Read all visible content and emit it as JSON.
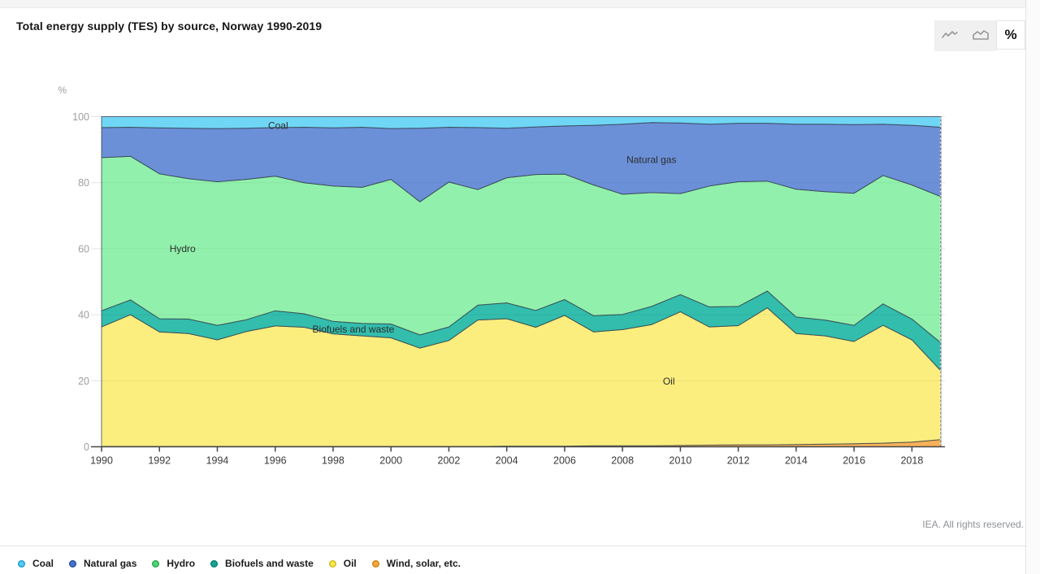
{
  "header": {
    "title": "Total energy supply (TES) by source, Norway 1990-2019"
  },
  "toolbar": {
    "line_chart_button": "line-chart-view",
    "area_chart_button": "area-chart-view",
    "percent_button_label": "%"
  },
  "footer": {
    "credit": "IEA. All rights reserved."
  },
  "legend": {
    "items": [
      {
        "label": "Coal",
        "color": "#55cdf2",
        "border": "#2b9fd0"
      },
      {
        "label": "Natural gas",
        "color": "#4673c8",
        "border": "#2f56a8"
      },
      {
        "label": "Hydro",
        "color": "#4fd476",
        "border": "#2fae55"
      },
      {
        "label": "Biofuels and waste",
        "color": "#16a394",
        "border": "#0d8578"
      },
      {
        "label": "Oil",
        "color": "#f7e84e",
        "border": "#d4bc2a"
      },
      {
        "label": "Wind, solar, etc.",
        "color": "#f2a83c",
        "border": "#cf8a1f"
      }
    ]
  },
  "chart_data": {
    "type": "area",
    "stacked": true,
    "normalized": "percent",
    "title": "Total energy supply (TES) by source, Norway 1990-2019",
    "ylabel": "%",
    "ylim": [
      0,
      100
    ],
    "yticks": [
      0,
      20,
      40,
      60,
      80,
      100
    ],
    "xticks": [
      1990,
      1992,
      1994,
      1996,
      1998,
      2000,
      2002,
      2004,
      2006,
      2008,
      2010,
      2012,
      2014,
      2016,
      2018
    ],
    "grid": "horizontal",
    "legend_position": "bottom",
    "dashed_marker_year": 2019,
    "years": [
      1990,
      1991,
      1992,
      1993,
      1994,
      1995,
      1996,
      1997,
      1998,
      1999,
      2000,
      2001,
      2002,
      2003,
      2004,
      2005,
      2006,
      2007,
      2008,
      2009,
      2010,
      2011,
      2012,
      2013,
      2014,
      2015,
      2016,
      2017,
      2018,
      2019
    ],
    "series": [
      {
        "name": "Coal",
        "color": "#70d6f5",
        "values": [
          3.3,
          3.2,
          3.4,
          3.5,
          3.6,
          3.5,
          3.3,
          3.2,
          3.4,
          3.2,
          3.6,
          3.5,
          3.2,
          3.3,
          3.5,
          3.1,
          2.8,
          2.6,
          2.3,
          1.8,
          1.9,
          2.3,
          2.0,
          2.0,
          2.3,
          2.3,
          2.4,
          2.3,
          2.6,
          3.2
        ]
      },
      {
        "name": "Natural gas",
        "color": "#6b90d8",
        "values": [
          9.1,
          8.8,
          13.9,
          15.3,
          16.1,
          15.5,
          14.7,
          16.8,
          17.6,
          18.2,
          15.4,
          22.3,
          16.6,
          18.8,
          15.0,
          14.4,
          14.6,
          18.1,
          21.2,
          21.2,
          21.4,
          18.7,
          17.7,
          17.5,
          19.7,
          20.4,
          20.8,
          15.5,
          18.1,
          21.0
        ]
      },
      {
        "name": "Hydro",
        "color": "#91f1ac",
        "values": [
          46.4,
          43.5,
          43.9,
          42.5,
          43.5,
          42.5,
          40.8,
          39.7,
          41.0,
          41.2,
          43.8,
          40.3,
          43.9,
          35.0,
          37.9,
          41.2,
          38.0,
          39.6,
          36.4,
          34.5,
          30.6,
          36.6,
          37.8,
          33.3,
          38.7,
          38.9,
          40.0,
          38.9,
          40.6,
          44.3
        ]
      },
      {
        "name": "Biofuels and waste",
        "color": "#32bdad",
        "values": [
          4.9,
          4.5,
          4.0,
          4.4,
          4.4,
          3.6,
          4.6,
          4.1,
          3.8,
          3.8,
          4.2,
          4.0,
          4.1,
          4.5,
          4.8,
          5.1,
          4.8,
          4.9,
          4.6,
          5.5,
          5.2,
          6.1,
          5.8,
          5.1,
          5.0,
          4.8,
          4.9,
          6.5,
          6.3,
          8.5
        ]
      },
      {
        "name": "Oil",
        "color": "#fbee7e",
        "values": [
          36.2,
          39.9,
          34.7,
          34.2,
          32.3,
          34.8,
          36.5,
          36.1,
          34.1,
          33.5,
          32.9,
          29.8,
          32.1,
          38.3,
          38.6,
          36.0,
          39.6,
          34.5,
          35.2,
          36.7,
          40.5,
          35.8,
          36.1,
          41.5,
          33.6,
          32.8,
          31.0,
          35.7,
          31.0,
          20.8
        ]
      },
      {
        "name": "Wind, solar, etc.",
        "color": "#f7b158",
        "values": [
          0.1,
          0.1,
          0.1,
          0.1,
          0.1,
          0.1,
          0.1,
          0.1,
          0.1,
          0.1,
          0.1,
          0.1,
          0.1,
          0.1,
          0.2,
          0.2,
          0.2,
          0.3,
          0.3,
          0.3,
          0.4,
          0.5,
          0.6,
          0.6,
          0.7,
          0.8,
          0.9,
          1.1,
          1.4,
          2.2
        ]
      }
    ],
    "annotations": [
      {
        "text": "Coal",
        "year": 1996.1,
        "value": 97.3
      },
      {
        "text": "Natural gas",
        "year": 2009.0,
        "value": 87.0
      },
      {
        "text": "Hydro",
        "year": 1992.8,
        "value": 60.0
      },
      {
        "text": "Biofuels and waste",
        "year": 1998.7,
        "value": 35.6
      },
      {
        "text": "Oil",
        "year": 2009.6,
        "value": 19.8
      }
    ]
  }
}
